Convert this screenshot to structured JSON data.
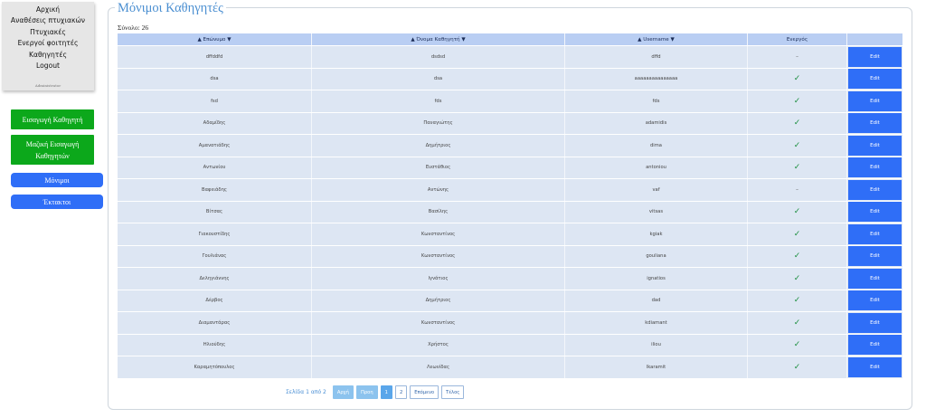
{
  "sidebar": {
    "menu": [
      "Αρχική",
      "Αναθέσεις πτυχιακών",
      "Πτυχιακές",
      "Ενεργοί φοιτητές",
      "Καθηγητές",
      "Logout"
    ],
    "admin_label": "Administrator"
  },
  "actions": {
    "insert_professor": "Εισαγωγή Καθηγητή",
    "bulk_insert_line1": "Μαζική Εισαγωγή",
    "bulk_insert_line2": "Καθηγητών",
    "permanent": "Μόνιμοι",
    "temporary": "Έκτακτοι"
  },
  "panel": {
    "title": "Μόνιμοι Καθηγητές",
    "total": "Σύνολο: 26"
  },
  "table": {
    "headers": [
      "▲ Επώνυμο ▼",
      "▲ Όνομα Καθηγητή ▼",
      "▲ Username ▼",
      "Ενεργός",
      ""
    ],
    "edit_label": "Edit",
    "rows": [
      {
        "surname": "dffddfd",
        "name": "dsdsd",
        "username": "dffd",
        "active": "–"
      },
      {
        "surname": "dsa",
        "name": "dsa",
        "username": "aaaaaaaaaaaaaaa",
        "active": "✓"
      },
      {
        "surname": "fsd",
        "name": "fds",
        "username": "fds",
        "active": "✓"
      },
      {
        "surname": "Αδαμίδης",
        "name": "Παναγιώτης",
        "username": "adamidis",
        "active": "✓"
      },
      {
        "surname": "Αμανατιάδης",
        "name": "Δημήτριος",
        "username": "dima",
        "active": "✓"
      },
      {
        "surname": "Αντωνίου",
        "name": "Ευστάθιος",
        "username": "antoniou",
        "active": "✓"
      },
      {
        "surname": "Βαφειάδης",
        "name": "Αντώνης",
        "username": "vaf",
        "active": "–"
      },
      {
        "surname": "Βίτσας",
        "name": "Βασίλης",
        "username": "vitsas",
        "active": "✓"
      },
      {
        "surname": "Γιακουστίδης",
        "name": "Κωνσταντίνος",
        "username": "kgiak",
        "active": "✓"
      },
      {
        "surname": "Γουλιάνας",
        "name": "Κωνσταντίνος",
        "username": "gouliana",
        "active": "✓"
      },
      {
        "surname": "Δεληγιάννης",
        "name": "Ιγνάτιος",
        "username": "ignatios",
        "active": "✓"
      },
      {
        "surname": "Δέρβος",
        "name": "Δημήτριος",
        "username": "dad",
        "active": "✓"
      },
      {
        "surname": "Διαμαντάρας",
        "name": "Κωνσταντίνος",
        "username": "kdiamant",
        "active": "✓"
      },
      {
        "surname": "Ηλιούδης",
        "name": "Χρήστος",
        "username": "iliou",
        "active": "✓"
      },
      {
        "surname": "Καραμητόπουλος",
        "name": "Λεωνίδας",
        "username": "lkaramit",
        "active": "✓"
      }
    ]
  },
  "pagination": {
    "info": "Σελίδα 1 από 2",
    "first": "Αρχή",
    "prev": "Προη",
    "page1": "1",
    "page2": "2",
    "next": "Επόμενο",
    "last": "Τέλος"
  }
}
